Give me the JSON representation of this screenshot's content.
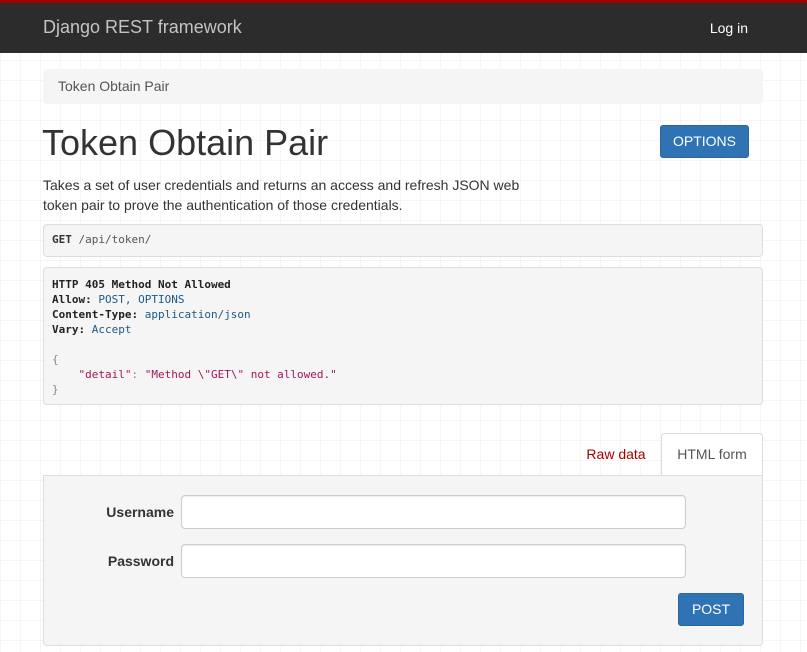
{
  "navbar": {
    "brand": "Django REST framework",
    "login_label": "Log in"
  },
  "breadcrumb": {
    "current": "Token Obtain Pair"
  },
  "page": {
    "title": "Token Obtain Pair",
    "options_label": "OPTIONS",
    "description": "Takes a set of user credentials and returns an access and refresh JSON web token pair to prove the authentication of those credentials."
  },
  "request": {
    "method": "GET",
    "path": "/api/token/"
  },
  "response": {
    "status_line": "HTTP 405 Method Not Allowed",
    "headers": [
      {
        "name": "Allow:",
        "value": "POST, OPTIONS"
      },
      {
        "name": "Content-Type:",
        "value": "application/json"
      },
      {
        "name": "Vary:",
        "value": "Accept"
      }
    ],
    "body_open": "{",
    "body_key": "\"detail\"",
    "body_colon": ":",
    "body_value": "\"Method \\\"GET\\\" not allowed.\"",
    "body_close": "}"
  },
  "tabs": {
    "raw_data": "Raw data",
    "html_form": "HTML form"
  },
  "form": {
    "username_label": "Username",
    "username_value": "",
    "password_label": "Password",
    "password_value": "",
    "submit_label": "POST"
  },
  "colors": {
    "navbar_bg": "#2c2c2c",
    "navbar_accent": "#a30000",
    "primary_button": "#2f73b5",
    "tab_link": "#a30000"
  }
}
